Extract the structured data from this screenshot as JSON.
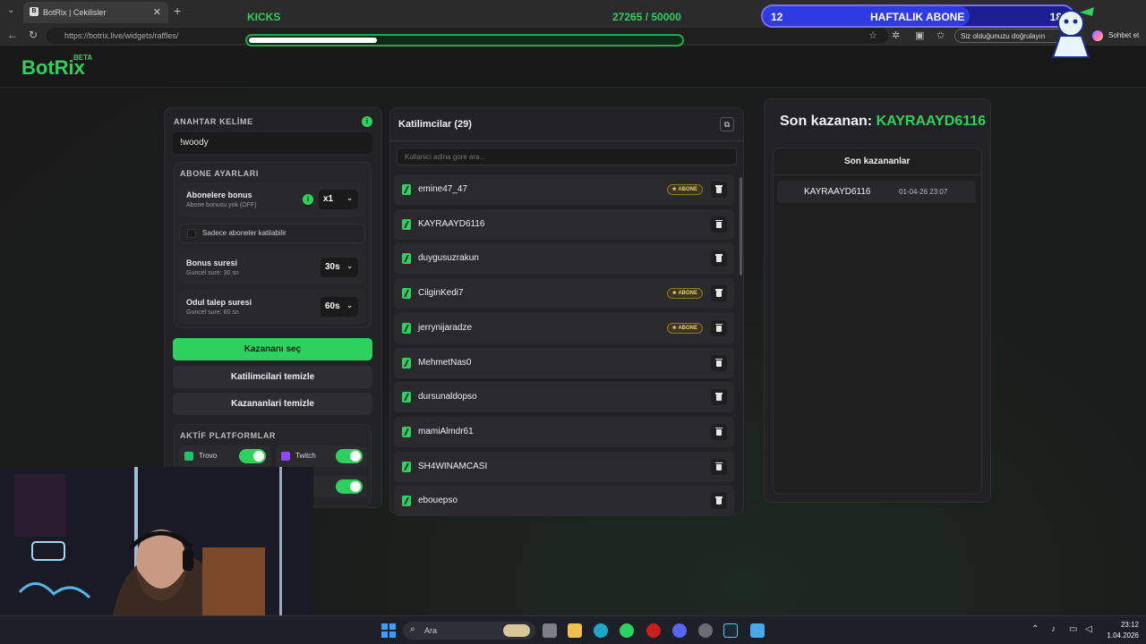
{
  "browser": {
    "tab_title": "BotRix | Cekilisler",
    "tab_favicon": "B",
    "url": "https://botrix.live/widgets/raffles/",
    "verify_text": "Siz olduğunuzu doğrulayın",
    "chat_button": "Sohbet et"
  },
  "overlay": {
    "kicks_label": "KICKS",
    "kicks_count": "27265 / 50000",
    "kicks_progress": 0.545,
    "sub_left": "12",
    "sub_title": "HAFTALIK ABONE",
    "sub_right": "18",
    "sub_progress": 0.667,
    "colors": {
      "kick_green": "#2bd15c",
      "sub_blue": "#2f3be0"
    }
  },
  "app": {
    "logo": "BotRix",
    "logo_beta": "BETA",
    "brand_color": "#2ed15e"
  },
  "settings": {
    "keyword_label": "ANAHTAR KELİME",
    "keyword_value": "!woody",
    "sub_settings_label": "ABONE AYARLARI",
    "sub_bonus_title": "Abonelere bonus",
    "sub_bonus_sub": "Abone bonusu yok (OFF)",
    "sub_bonus_value": "x1",
    "only_subs": "Sadece aboneler katilabilir",
    "bonus_time_title": "Bonus suresi",
    "bonus_time_sub": "Guncel sure: 30 sn",
    "bonus_time_value": "30s",
    "claim_time_title": "Odul talep suresi",
    "claim_time_sub": "Guncel sure: 60 sn",
    "claim_time_value": "60s",
    "pick_winner": "Kazananı seç",
    "clear_participants": "Katilimcilari temizle",
    "clear_winners": "Kazananlari temizle",
    "platforms_label": "AKTİF PLATFORMLAR",
    "platforms": [
      {
        "name": "Trovo",
        "enabled": true
      },
      {
        "name": "Twitch",
        "enabled": true
      },
      {
        "name": "",
        "enabled": true
      }
    ]
  },
  "participants": {
    "title": "Katilimcilar (29)",
    "search_placeholder": "Kullanici adina gore ara...",
    "badge_label": "ABONE",
    "list": [
      {
        "name": "emine47_47",
        "sub": true
      },
      {
        "name": "KAYRAAYD6116",
        "sub": false
      },
      {
        "name": "duygusuzrakun",
        "sub": false
      },
      {
        "name": "CilginKedi7",
        "sub": true
      },
      {
        "name": "jerrynijaradze",
        "sub": true
      },
      {
        "name": "MehmetNas0",
        "sub": false
      },
      {
        "name": "dursunaldopso",
        "sub": false
      },
      {
        "name": "mamiAlmdr61",
        "sub": false
      },
      {
        "name": "SH4WINAMCASI",
        "sub": false
      },
      {
        "name": "ebouepso",
        "sub": false
      }
    ]
  },
  "winner": {
    "label": "Son kazanan:",
    "name": "KAYRAAYD6116",
    "list_title": "Son kazananlar",
    "list": [
      {
        "name": "KAYRAAYD6116",
        "time": "01-04-26 23:07"
      }
    ]
  },
  "taskbar": {
    "search": "Ara",
    "time": "23:12",
    "date": "1.04.2026"
  }
}
